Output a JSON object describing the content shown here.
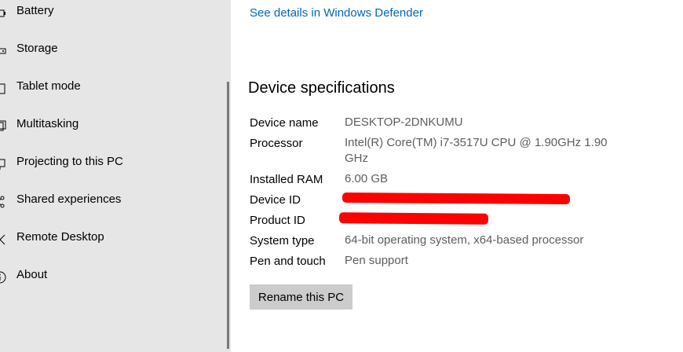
{
  "sidebar": {
    "items": [
      {
        "label": "Battery",
        "icon": "battery-icon"
      },
      {
        "label": "Storage",
        "icon": "storage-icon"
      },
      {
        "label": "Tablet mode",
        "icon": "tablet-mode-icon"
      },
      {
        "label": "Multitasking",
        "icon": "multitasking-icon"
      },
      {
        "label": "Projecting to this PC",
        "icon": "projecting-icon"
      },
      {
        "label": "Shared experiences",
        "icon": "shared-experiences-icon"
      },
      {
        "label": "Remote Desktop",
        "icon": "remote-desktop-icon"
      },
      {
        "label": "About",
        "icon": "about-icon"
      }
    ]
  },
  "main": {
    "defender_link": "See details in Windows Defender",
    "section_title": "Device specifications",
    "specs": [
      {
        "key": "Device name",
        "value": "DESKTOP-2DNKUMU"
      },
      {
        "key": "Processor",
        "value": "Intel(R) Core(TM) i7-3517U CPU @ 1.90GHz   1.90",
        "value_cont": "GHz"
      },
      {
        "key": "Installed RAM",
        "value": "6.00 GB"
      },
      {
        "key": "Device ID",
        "value": ""
      },
      {
        "key": "Product ID",
        "value": ""
      },
      {
        "key": "System type",
        "value": "64-bit operating system, x64-based processor"
      },
      {
        "key": "Pen and touch",
        "value": "Pen support"
      }
    ],
    "rename_button": "Rename this PC"
  },
  "colors": {
    "sidebar_bg": "#e6e6e6",
    "link": "#0067b8",
    "value_text": "#5d5d5d",
    "redaction": "#ff0000",
    "button_bg": "#cccccc"
  }
}
